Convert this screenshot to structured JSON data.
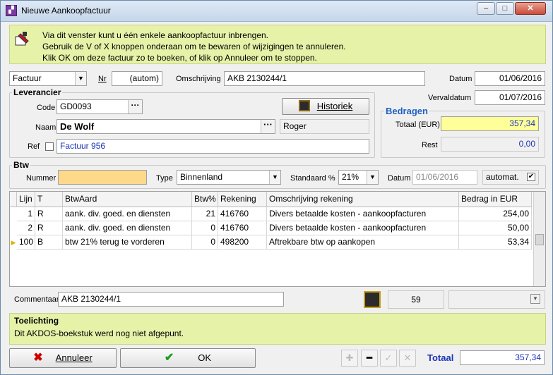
{
  "window": {
    "title": "Nieuwe Aankoopfactuur"
  },
  "info": {
    "line1": "Via dit venster kunt u één enkele aankoopfactuur inbrengen.",
    "line2": "Gebruik de V of X knoppen onderaan om te bewaren of wijzigingen te annuleren.",
    "line3": "Klik OK om deze factuur zo te boeken, of klik op Annuleer om te stoppen."
  },
  "header": {
    "type_value": "Factuur",
    "nr_label": "Nr",
    "nr_value": "(autom)",
    "omschrijving_label": "Omschrijving",
    "omschrijving_value": "AKB 2130244/1",
    "datum_label": "Datum",
    "datum_value": "01/06/2016",
    "vervaldatum_label": "Vervaldatum",
    "vervaldatum_value": "01/07/2016"
  },
  "leverancier": {
    "title": "Leverancier",
    "code_label": "Code",
    "code_value": "GD0093",
    "historiek_label": "Historiek",
    "naam_label": "Naam",
    "naam_value": "De Wolf",
    "contact_value": "Roger",
    "ref_label": "Ref",
    "ref_value": "Factuur 956"
  },
  "bedragen": {
    "title": "Bedragen",
    "totaal_label": "Totaal (EUR)",
    "totaal_value": "357,34",
    "rest_label": "Rest",
    "rest_value": "0,00"
  },
  "btw": {
    "title": "Btw",
    "nummer_label": "Nummer",
    "nummer_value": "",
    "type_label": "Type",
    "type_value": "Binnenland",
    "standaard_label": "Standaard %",
    "standaard_value": "21%",
    "datum_label": "Datum",
    "datum_value": "01/06/2016",
    "automat_label": "automat."
  },
  "grid": {
    "columns": [
      "Lijn",
      "T",
      "BtwAard",
      "Btw%",
      "Rekening",
      "Omschrijving rekening",
      "Bedrag in EUR"
    ],
    "rows": [
      {
        "lijn": "1",
        "t": "R",
        "aard": "aank. div. goed. en diensten",
        "btw": "21",
        "rek": "416760",
        "oms": "Divers betaalde kosten - aankoopfacturen",
        "bedrag": "254,00"
      },
      {
        "lijn": "2",
        "t": "R",
        "aard": "aank. div. goed. en diensten",
        "btw": "0",
        "rek": "416760",
        "oms": "Divers betaalde kosten - aankoopfacturen",
        "bedrag": "50,00"
      },
      {
        "lijn": "100",
        "t": "B",
        "aard": "btw 21% terug te vorderen",
        "btw": "0",
        "rek": "498200",
        "oms": "Aftrekbare btw op aankopen",
        "bedrag": "53,34"
      }
    ]
  },
  "commentaar": {
    "label": "Commentaar",
    "value": "AKB 2130244/1",
    "count": "59"
  },
  "toelichting": {
    "title": "Toelichting",
    "text": "Dit AKDOS-boekstuk werd nog niet afgepunt."
  },
  "footer": {
    "annuleer_label": "Annuleer",
    "ok_label": "OK",
    "totaal_label": "Totaal",
    "totaal_value": "357,34"
  },
  "colors": {
    "info_bg": "#e6f2a8",
    "highlight_yellow": "#ffff99",
    "btw_field": "#ffd98a",
    "bedragen_title": "#1f5fbf",
    "value_blue": "#1a35b8"
  }
}
